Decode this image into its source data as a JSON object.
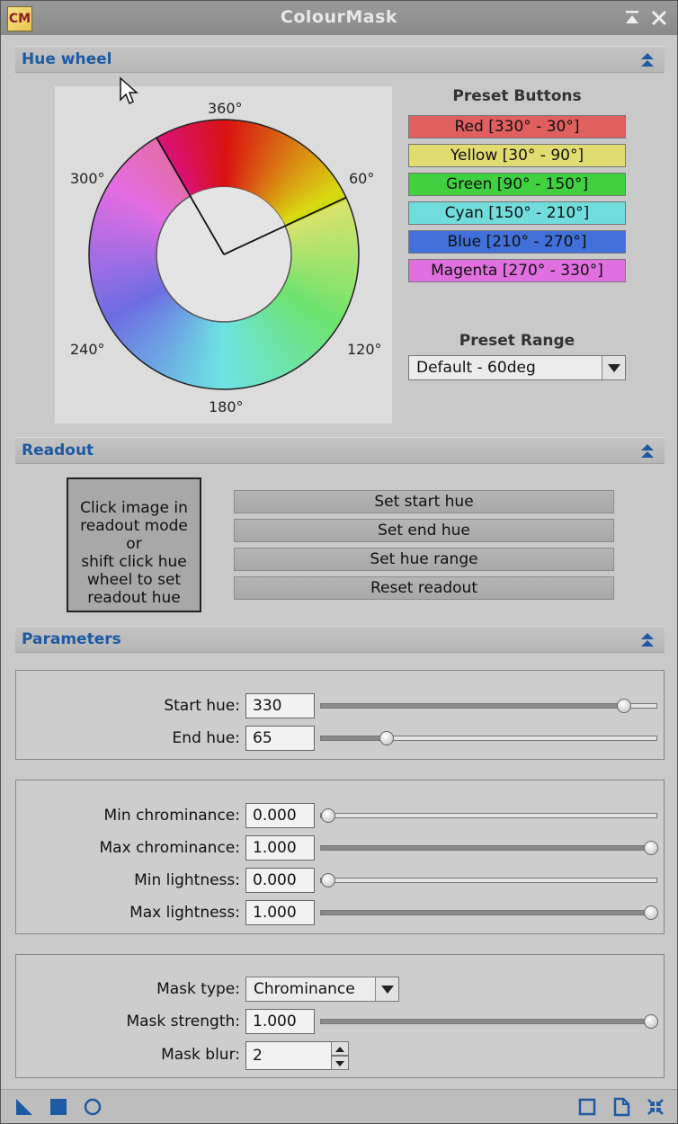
{
  "window": {
    "title": "ColourMask",
    "app_icon_text": "CM"
  },
  "sections": {
    "hue_wheel": "Hue wheel",
    "readout": "Readout",
    "parameters": "Parameters"
  },
  "wheel": {
    "labels": {
      "a360": "360°",
      "a60": "60°",
      "a120": "120°",
      "a180": "180°",
      "a240": "240°",
      "a300": "300°"
    }
  },
  "presets": {
    "heading": "Preset Buttons",
    "buttons": [
      {
        "label": "Red [330° - 30°]",
        "color": "#e06060"
      },
      {
        "label": "Yellow [30° - 90°]",
        "color": "#e0dc70"
      },
      {
        "label": "Green [90° - 150°]",
        "color": "#40d040"
      },
      {
        "label": "Cyan [150° - 210°]",
        "color": "#70dcdc"
      },
      {
        "label": "Blue [210° - 270°]",
        "color": "#4070d8"
      },
      {
        "label": "Magenta [270° - 330°]",
        "color": "#e070e0"
      }
    ],
    "range_heading": "Preset Range",
    "range_value": "Default - 60deg"
  },
  "readout": {
    "box_lines": [
      "Click image in",
      "readout mode or",
      "shift click hue",
      "wheel to set",
      "readout hue"
    ],
    "buttons": [
      "Set start hue",
      "Set end hue",
      "Set hue range",
      "Reset readout"
    ]
  },
  "params": {
    "start_hue": {
      "label": "Start hue:",
      "value": "330",
      "slider": 0.917
    },
    "end_hue": {
      "label": "End hue:",
      "value": "65",
      "slider": 0.18
    },
    "min_chrominance": {
      "label": "Min chrominance:",
      "value": "0.000",
      "slider": 0.0
    },
    "max_chrominance": {
      "label": "Max chrominance:",
      "value": "1.000",
      "slider": 1.0
    },
    "min_lightness": {
      "label": "Min lightness:",
      "value": "0.000",
      "slider": 0.0
    },
    "max_lightness": {
      "label": "Max lightness:",
      "value": "1.000",
      "slider": 1.0
    },
    "mask_type": {
      "label": "Mask type:",
      "value": "Chrominance"
    },
    "mask_strength": {
      "label": "Mask strength:",
      "value": "1.000",
      "slider": 1.0
    },
    "mask_blur": {
      "label": "Mask blur:",
      "value": "2"
    }
  },
  "accent_color": "#1d5aa3"
}
